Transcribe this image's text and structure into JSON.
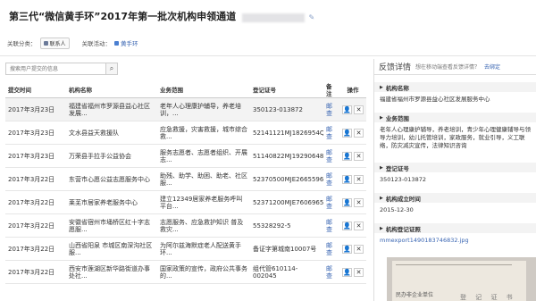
{
  "header": {
    "title": "第三代“微信黄手环”2017年第一批次机构申领通道"
  },
  "meta": {
    "category_label": "关联分类：",
    "category_tag": "联系人",
    "activity_label": "关联活动：",
    "activity_tag": "黄手环"
  },
  "search": {
    "placeholder": "搜索用户提交的信息"
  },
  "table": {
    "headers": [
      "提交时间",
      "机构名称",
      "业务范围",
      "登记证号",
      "备注",
      "操作"
    ],
    "rows": [
      {
        "time": "2017年3月23日",
        "org": "福建省福州市罗源县益心社区发展...",
        "scope": "老年人心理康护辅导，养老培训，...",
        "reg": "350123-013872",
        "note": "邮查"
      },
      {
        "time": "2017年3月23日",
        "org": "文水县益天救援队",
        "scope": "应急救援，灾害救援，城市综合救...",
        "reg": "52141121MJ1826954Q",
        "note": "邮查"
      },
      {
        "time": "2017年3月23日",
        "org": "万荣县手拉手公益协会",
        "scope": "服务志愿者、志愿者组织、开展志...",
        "reg": "51140822MJ19290648",
        "note": "邮查"
      },
      {
        "time": "2017年3月22日",
        "org": "东营市心愿公益志愿服务中心",
        "scope": "助残、助学、助困、助老、社区服...",
        "reg": "52370500MJE2665596",
        "note": "邮查"
      },
      {
        "time": "2017年3月22日",
        "org": "莱芜市居家养老服务中心",
        "scope": "建立12349居家养老服务呼叫平台...",
        "reg": "52371200MJE7606965",
        "note": "邮查"
      },
      {
        "time": "2017年3月22日",
        "org": "安徽省宿州市埇桥区红十字志愿服...",
        "scope": "志愿服务、应急救护知识 普及 救灾...",
        "reg": "55328292-5",
        "note": "邮查"
      },
      {
        "time": "2017年3月22日",
        "org": "山西省阳泉 市城区南深沟社区服...",
        "scope": "为阿尔兹海默症老人配送黄手环...",
        "reg": "备证字第城南10007号",
        "note": "邮查"
      },
      {
        "time": "2017年3月22日",
        "org": "西安市莲湖区新华路街道办事处社...",
        "scope": "国家政策的宣传，政府公共事务的...",
        "reg": "组代管610114-002045",
        "note": "邮查"
      }
    ]
  },
  "panel": {
    "title": "反馈详情",
    "subtitle": "想在移动端查看反馈详情？",
    "subtitle_link": "去绑定",
    "sections": {
      "org_label": "机构名称",
      "org_value": "福建省福州市罗源县益心社区发展服务中心",
      "scope_label": "业务范围",
      "scope_value": "老年人心理康护辅导，养老培训，青少年心理健康辅导与领导力培训，幼儿托管培训，家政服务，就业引导，义工联络，防灾减灾宣传，法律知识咨询",
      "reg_label": "登记证号",
      "reg_value": "350123-013872",
      "date_label": "机构成立时间",
      "date_value": "2015-12-30",
      "cert_label": "机构登记证照",
      "cert_link": "mmexport1490183746832.jpg"
    },
    "doc_text": "民办非企业单位",
    "doc_text2": "登 记 证 书"
  },
  "colors": {
    "link": "#3a66b3",
    "label_bg": "#f3f3f3"
  }
}
